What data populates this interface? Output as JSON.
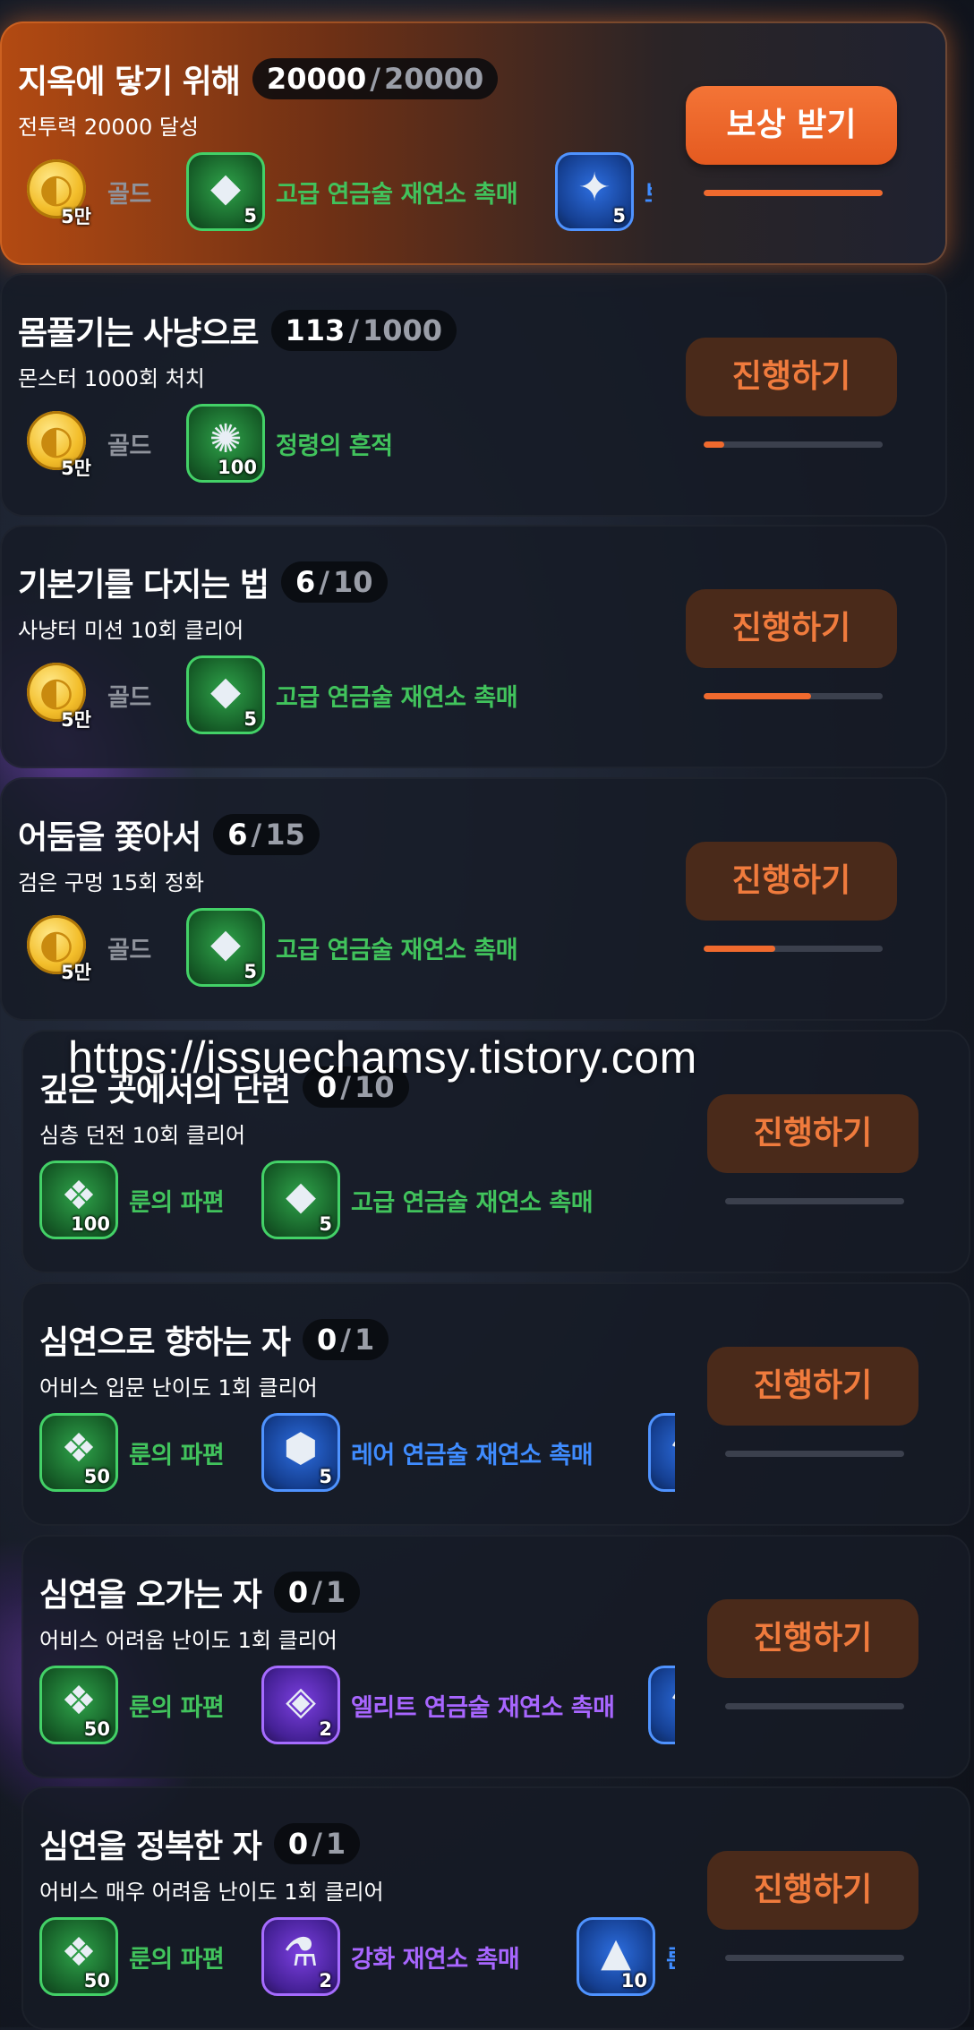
{
  "watermark": "https://issuechamsy.tistory.com",
  "colors": {
    "accent_orange": "#f06a2e",
    "label_green": "#41c35c",
    "label_blue": "#3f8cff",
    "label_purple": "#a866ff",
    "label_gray": "#8f939c"
  },
  "missions": [
    {
      "title": "지옥에 닿기 위해",
      "current": "20000",
      "max": "20000",
      "description": "전투력 20000 달성",
      "button": "보상 받기",
      "state": "claim",
      "progress": 1.0,
      "rewards": [
        {
          "icon": "gold-coin-icon",
          "qty": "5만",
          "label": "골드",
          "color": "gray"
        },
        {
          "icon": "stone-catalyst-icon",
          "qty": "5",
          "label": "고급 연금술 재연소 촉매",
          "color": "green"
        },
        {
          "icon": "crystal-shard-icon",
          "qty": "5",
          "label": "보",
          "color": "blue"
        }
      ]
    },
    {
      "title": "몸풀기는 사냥으로",
      "current": "113",
      "max": "1000",
      "description": "몬스터 1000회 처치",
      "button": "진행하기",
      "state": "go",
      "progress": 0.113,
      "rewards": [
        {
          "icon": "gold-coin-icon",
          "qty": "5만",
          "label": "골드",
          "color": "gray"
        },
        {
          "icon": "spirit-trace-icon",
          "qty": "100",
          "label": "정령의 흔적",
          "color": "green"
        }
      ]
    },
    {
      "title": "기본기를 다지는 법",
      "current": "6",
      "max": "10",
      "description": "사냥터 미션 10회 클리어",
      "button": "진행하기",
      "state": "go",
      "progress": 0.6,
      "rewards": [
        {
          "icon": "gold-coin-icon",
          "qty": "5만",
          "label": "골드",
          "color": "gray"
        },
        {
          "icon": "stone-catalyst-icon",
          "qty": "5",
          "label": "고급 연금술 재연소 촉매",
          "color": "green"
        }
      ]
    },
    {
      "title": "어둠을 쫓아서",
      "current": "6",
      "max": "15",
      "description": "검은 구멍 15회 정화",
      "button": "진행하기",
      "state": "go",
      "progress": 0.4,
      "rewards": [
        {
          "icon": "gold-coin-icon",
          "qty": "5만",
          "label": "골드",
          "color": "gray"
        },
        {
          "icon": "stone-catalyst-icon",
          "qty": "5",
          "label": "고급 연금술 재연소 촉매",
          "color": "green"
        }
      ]
    },
    {
      "title": "깊은 곳에서의 단련",
      "current": "0",
      "max": "10",
      "description": "심층 던전 10회 클리어",
      "button": "진행하기",
      "state": "go",
      "progress": 0.0,
      "rewards": [
        {
          "icon": "rune-fragment-icon",
          "qty": "100",
          "label": "룬의 파편",
          "color": "green"
        },
        {
          "icon": "stone-catalyst-icon",
          "qty": "5",
          "label": "고급 연금술 재연소 촉매",
          "color": "green"
        }
      ]
    },
    {
      "title": "심연으로 향하는 자",
      "current": "0",
      "max": "1",
      "description": "어비스 입문 난이도 1회 클리어",
      "button": "진행하기",
      "state": "go",
      "progress": 0.0,
      "rewards": [
        {
          "icon": "rune-fragment-icon",
          "qty": "50",
          "label": "룬의 파편",
          "color": "green"
        },
        {
          "icon": "rare-catalyst-icon",
          "qty": "5",
          "label": "레어 연금술 재연소 촉매",
          "color": "blue"
        },
        {
          "icon": "potion-vial-icon",
          "qty": "",
          "label": "",
          "color": "blue"
        }
      ]
    },
    {
      "title": "심연을 오가는 자",
      "current": "0",
      "max": "1",
      "description": "어비스 어려움 난이도 1회 클리어",
      "button": "진행하기",
      "state": "go",
      "progress": 0.0,
      "rewards": [
        {
          "icon": "rune-fragment-icon",
          "qty": "50",
          "label": "룬의 파편",
          "color": "green"
        },
        {
          "icon": "elite-catalyst-icon",
          "qty": "2",
          "label": "엘리트 연금술 재연소 촉매",
          "color": "purple"
        },
        {
          "icon": "potion-vial-icon",
          "qty": "",
          "label": "",
          "color": "blue"
        }
      ]
    },
    {
      "title": "심연을 정복한 자",
      "current": "0",
      "max": "1",
      "description": "어비스 매우 어려움 난이도 1회 클리어",
      "button": "진행하기",
      "state": "go",
      "progress": 0.0,
      "rewards": [
        {
          "icon": "rune-fragment-icon",
          "qty": "50",
          "label": "룬의 파편",
          "color": "green"
        },
        {
          "icon": "enhance-catalyst-icon",
          "qty": "2",
          "label": "강화 재연소 촉매",
          "color": "purple"
        },
        {
          "icon": "rune-stone-icon",
          "qty": "10",
          "label": "룬 재",
          "color": "blue"
        }
      ]
    }
  ]
}
